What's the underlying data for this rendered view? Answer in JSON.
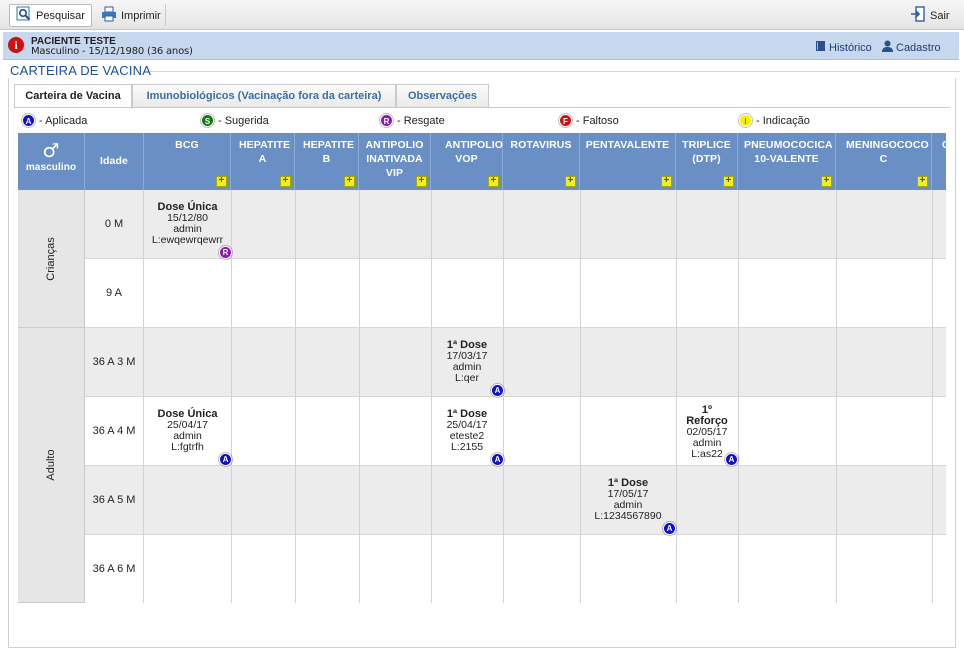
{
  "toolbar": {
    "search_label": "Pesquisar",
    "print_label": "Imprimir",
    "exit_label": "Sair"
  },
  "patient": {
    "name": "PACIENTE TESTE",
    "info": "Masculino - 15/12/1980 (36 anos)",
    "history_label": "Histórico",
    "register_label": "Cadastro"
  },
  "section_title": "CARTEIRA DE VACINA",
  "tabs": [
    "Carteira de Vacina",
    "Imunobiológicos (Vacinação fora da carteira)",
    "Observações"
  ],
  "legend": [
    {
      "letter": "A",
      "label": "- Aplicada",
      "color": "#1010c8"
    },
    {
      "letter": "S",
      "label": "- Sugerida",
      "color": "#107a10"
    },
    {
      "letter": "R",
      "label": "- Resgate",
      "color": "#8a1ab0"
    },
    {
      "letter": "F",
      "label": "- Faltoso",
      "color": "#d01010"
    },
    {
      "letter": "I",
      "label": "- Indicação",
      "color": "#f2f200"
    }
  ],
  "grid": {
    "gender_label": "masculino",
    "age_header": "Idade",
    "vaccines": [
      "BCG",
      "HEPATITE A",
      "HEPATITE B",
      "ANTIPOLIO INATIVADA VIP",
      "ANTIPOLIO VOP",
      "ROTAVIRUS",
      "PENTAVALENTE",
      "TRIPLICE (DTP)",
      "PNEUMOCOCICA 10-VALENTE",
      "MENINGOCOCO C",
      "C"
    ],
    "groups": [
      {
        "label": "Crianças",
        "rows": [
          "0 M",
          "9 A"
        ]
      },
      {
        "label": "Adulto",
        "rows": [
          "36 A 3 M",
          "36 A 4 M",
          "36 A 5 M",
          "36 A 6 M"
        ]
      }
    ],
    "doses": [
      {
        "row": 0,
        "col": 0,
        "title": "Dose Única",
        "date": "15/12/80",
        "user": "admin",
        "lot": "L:ewqewrqewrr",
        "status": "R"
      },
      {
        "row": 2,
        "col": 4,
        "title": "1ª Dose",
        "date": "17/03/17",
        "user": "admin",
        "lot": "L:qer",
        "status": "A"
      },
      {
        "row": 3,
        "col": 0,
        "title": "Dose Única",
        "date": "25/04/17",
        "user": "admin",
        "lot": "L:fgtrfh",
        "status": "A"
      },
      {
        "row": 3,
        "col": 4,
        "title": "1ª Dose",
        "date": "25/04/17",
        "user": "eteste2",
        "lot": "L:2155",
        "status": "A"
      },
      {
        "row": 3,
        "col": 7,
        "title": "1º Reforço",
        "date": "02/05/17",
        "user": "admin",
        "lot": "L:as22",
        "status": "A"
      },
      {
        "row": 4,
        "col": 6,
        "title": "1ª Dose",
        "date": "17/05/17",
        "user": "admin",
        "lot": "L:1234567890",
        "status": "A"
      }
    ]
  }
}
